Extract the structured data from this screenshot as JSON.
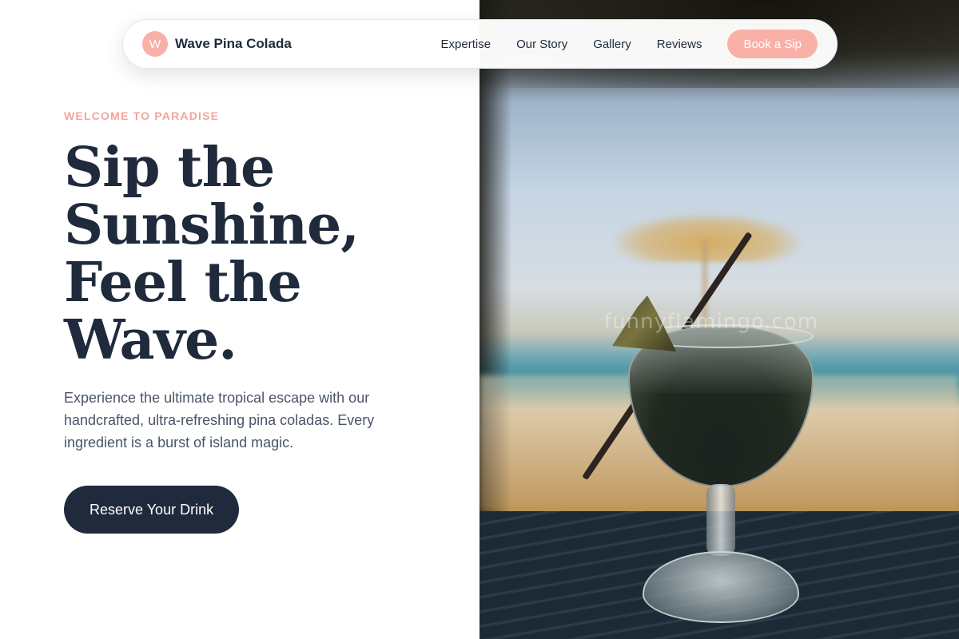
{
  "brand": {
    "initial": "W",
    "name": "Wave Pina Colada"
  },
  "nav": {
    "links": [
      "Expertise",
      "Our Story",
      "Gallery",
      "Reviews"
    ],
    "cta_label": "Book a Sip"
  },
  "hero": {
    "eyebrow": "WELCOME TO PARADISE",
    "headline_lines": [
      "Sip the",
      "Sunshine,",
      "Feel the",
      "Wave."
    ],
    "lead": "Experience the ultimate tropical escape with our handcrafted, ultra-refreshing pina coladas. Every ingredient is a burst of island magic.",
    "cta_label": "Reserve Your Drink"
  },
  "photo": {
    "watermark": "funnyflamingo.com"
  },
  "colors": {
    "accent": "#f9b0a7",
    "eyebrow": "#f4a59b",
    "ink": "#1f2a3c",
    "body_text": "#4a5568"
  }
}
